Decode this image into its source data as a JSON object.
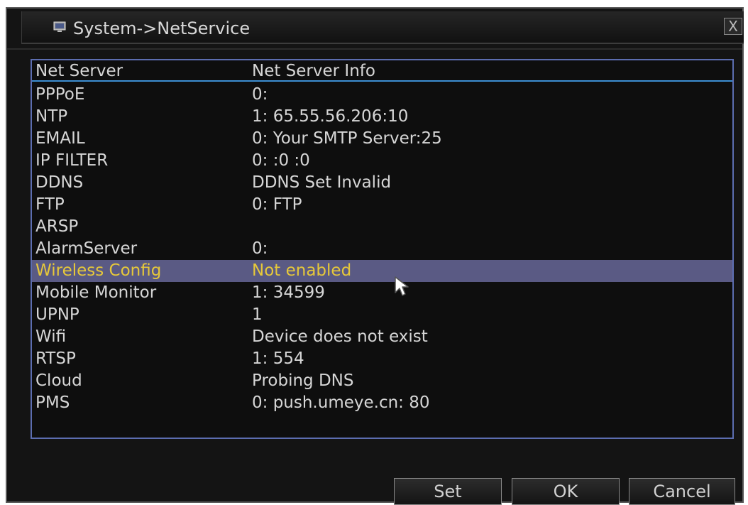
{
  "window": {
    "title": "System->NetService",
    "close_label": "X"
  },
  "table": {
    "headers": [
      "Net Server",
      "Net Server Info"
    ],
    "rows": [
      {
        "name": "PPPoE",
        "info": "0:"
      },
      {
        "name": "NTP",
        "info": "1: 65.55.56.206:10"
      },
      {
        "name": "EMAIL",
        "info": "0: Your SMTP Server:25"
      },
      {
        "name": "IP FILTER",
        "info": "0: :0 :0"
      },
      {
        "name": "DDNS",
        "info": "DDNS Set Invalid"
      },
      {
        "name": "FTP",
        "info": "0: FTP"
      },
      {
        "name": "ARSP",
        "info": ""
      },
      {
        "name": "AlarmServer",
        "info": "0:"
      },
      {
        "name": "Wireless Config",
        "info": "Not enabled",
        "selected": true
      },
      {
        "name": "Mobile Monitor",
        "info": "1: 34599"
      },
      {
        "name": "UPNP",
        "info": "1"
      },
      {
        "name": "Wifi",
        "info": "Device does not exist"
      },
      {
        "name": "RTSP",
        "info": "1: 554"
      },
      {
        "name": "Cloud",
        "info": "Probing DNS"
      },
      {
        "name": "PMS",
        "info": "0: push.umeye.cn: 80"
      }
    ]
  },
  "buttons": {
    "set": "Set",
    "ok": "OK",
    "cancel": "Cancel"
  },
  "colors": {
    "selected_row_bg": "#5a5a84",
    "selected_row_text": "#e6c83a",
    "list_border": "#5c6db0",
    "header_separator": "#3c8ed2"
  }
}
